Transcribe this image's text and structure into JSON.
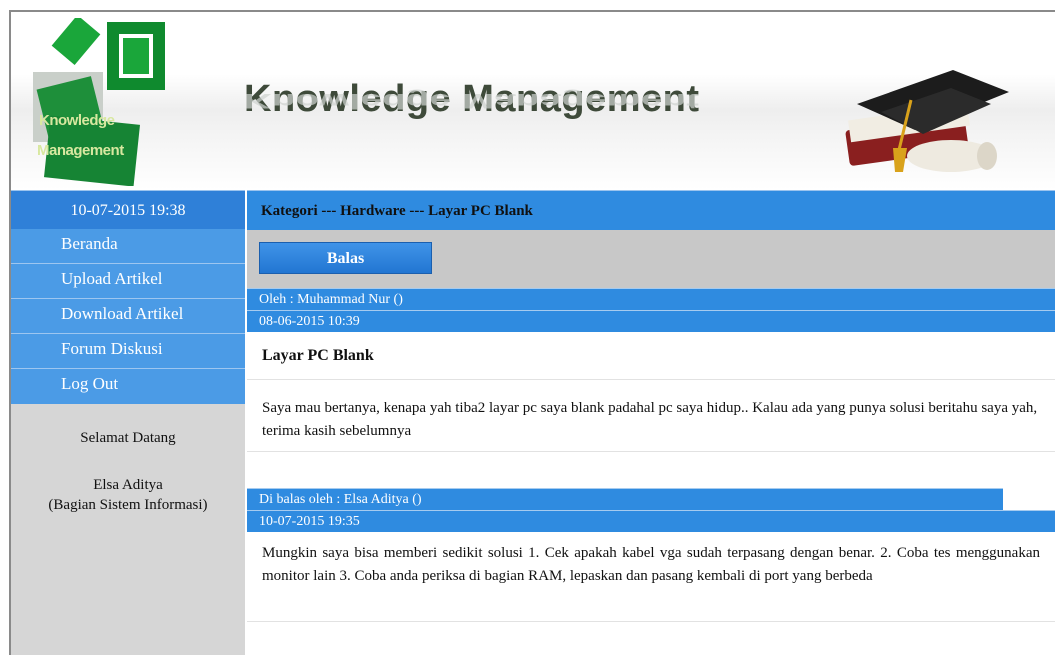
{
  "header": {
    "logo_line1": "Knowledge",
    "logo_line2": "Management",
    "title": "Knowledge Management"
  },
  "sidebar": {
    "datetime": "10-07-2015 19:38",
    "menu": [
      {
        "label": "Beranda"
      },
      {
        "label": "Upload Artikel"
      },
      {
        "label": "Download Artikel"
      },
      {
        "label": "Forum Diskusi"
      },
      {
        "label": "Log Out"
      }
    ],
    "welcome": "Selamat Datang",
    "user_name": "Elsa Aditya",
    "user_dept": "(Bagian Sistem Informasi)"
  },
  "main": {
    "breadcrumb": "Kategori --- Hardware --- Layar PC Blank",
    "reply_button": "Balas",
    "post": {
      "author": "Oleh : Muhammad Nur ()",
      "date": "08-06-2015 10:39",
      "title": "Layar PC Blank",
      "body": "Saya mau bertanya, kenapa yah tiba2 layar pc saya blank padahal pc saya hidup.. Kalau ada yang punya solusi beritahu saya yah, terima kasih sebelumnya"
    },
    "reply": {
      "author": "Di balas oleh : Elsa Aditya ()",
      "date": "10-07-2015 19:35",
      "body": "Mungkin saya bisa memberi sedikit solusi 1. Cek apakah kabel vga sudah terpasang dengan benar. 2. Coba tes menggunakan monitor lain 3. Coba anda periksa di bagian RAM, lepaskan dan pasang kembali di port yang berbeda"
    }
  },
  "colors": {
    "primary_blue": "#2f8be0",
    "menu_blue": "#4b9be6",
    "sidebar_gray": "#d6d6d6",
    "logo_green": "#1a9a3a"
  }
}
